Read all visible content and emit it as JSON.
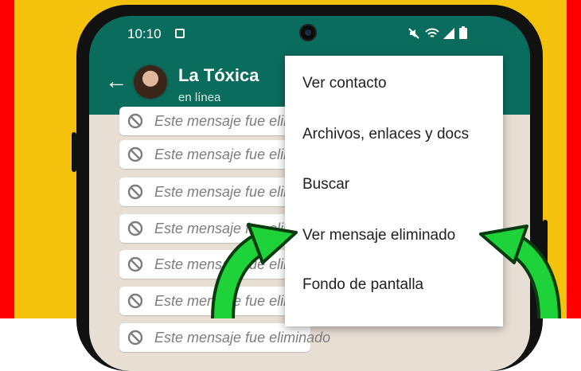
{
  "status_bar": {
    "time": "10:10",
    "icons": [
      "notification-icon",
      "mute-icon",
      "wifi-icon",
      "signal-icon",
      "battery-icon"
    ]
  },
  "chat_header": {
    "back_icon": "back-arrow-icon",
    "contact_name": "La Tóxica",
    "contact_status": "en línea"
  },
  "messages": [
    {
      "text": "Este mensaje fue eliminado"
    },
    {
      "text": "Este mensaje fue eliminado"
    },
    {
      "text": "Este mensaje fue eliminado"
    },
    {
      "text": "Este mensaje fue eliminado"
    },
    {
      "text": "Este mensaje fue eliminado"
    },
    {
      "text": "Este mensaje fue eliminado"
    },
    {
      "text": "Este mensaje fue eliminado"
    }
  ],
  "menu": {
    "items": [
      {
        "label": "Ver contacto"
      },
      {
        "label": "Archivos, enlaces y docs"
      },
      {
        "label": "Buscar"
      },
      {
        "label": "Ver mensaje eliminado"
      },
      {
        "label": "Fondo de pantalla"
      }
    ]
  },
  "colors": {
    "header": "#0a6c5d",
    "background": "#f4c20d",
    "frame": "#ff0000",
    "arrow": "#1ed33a"
  }
}
